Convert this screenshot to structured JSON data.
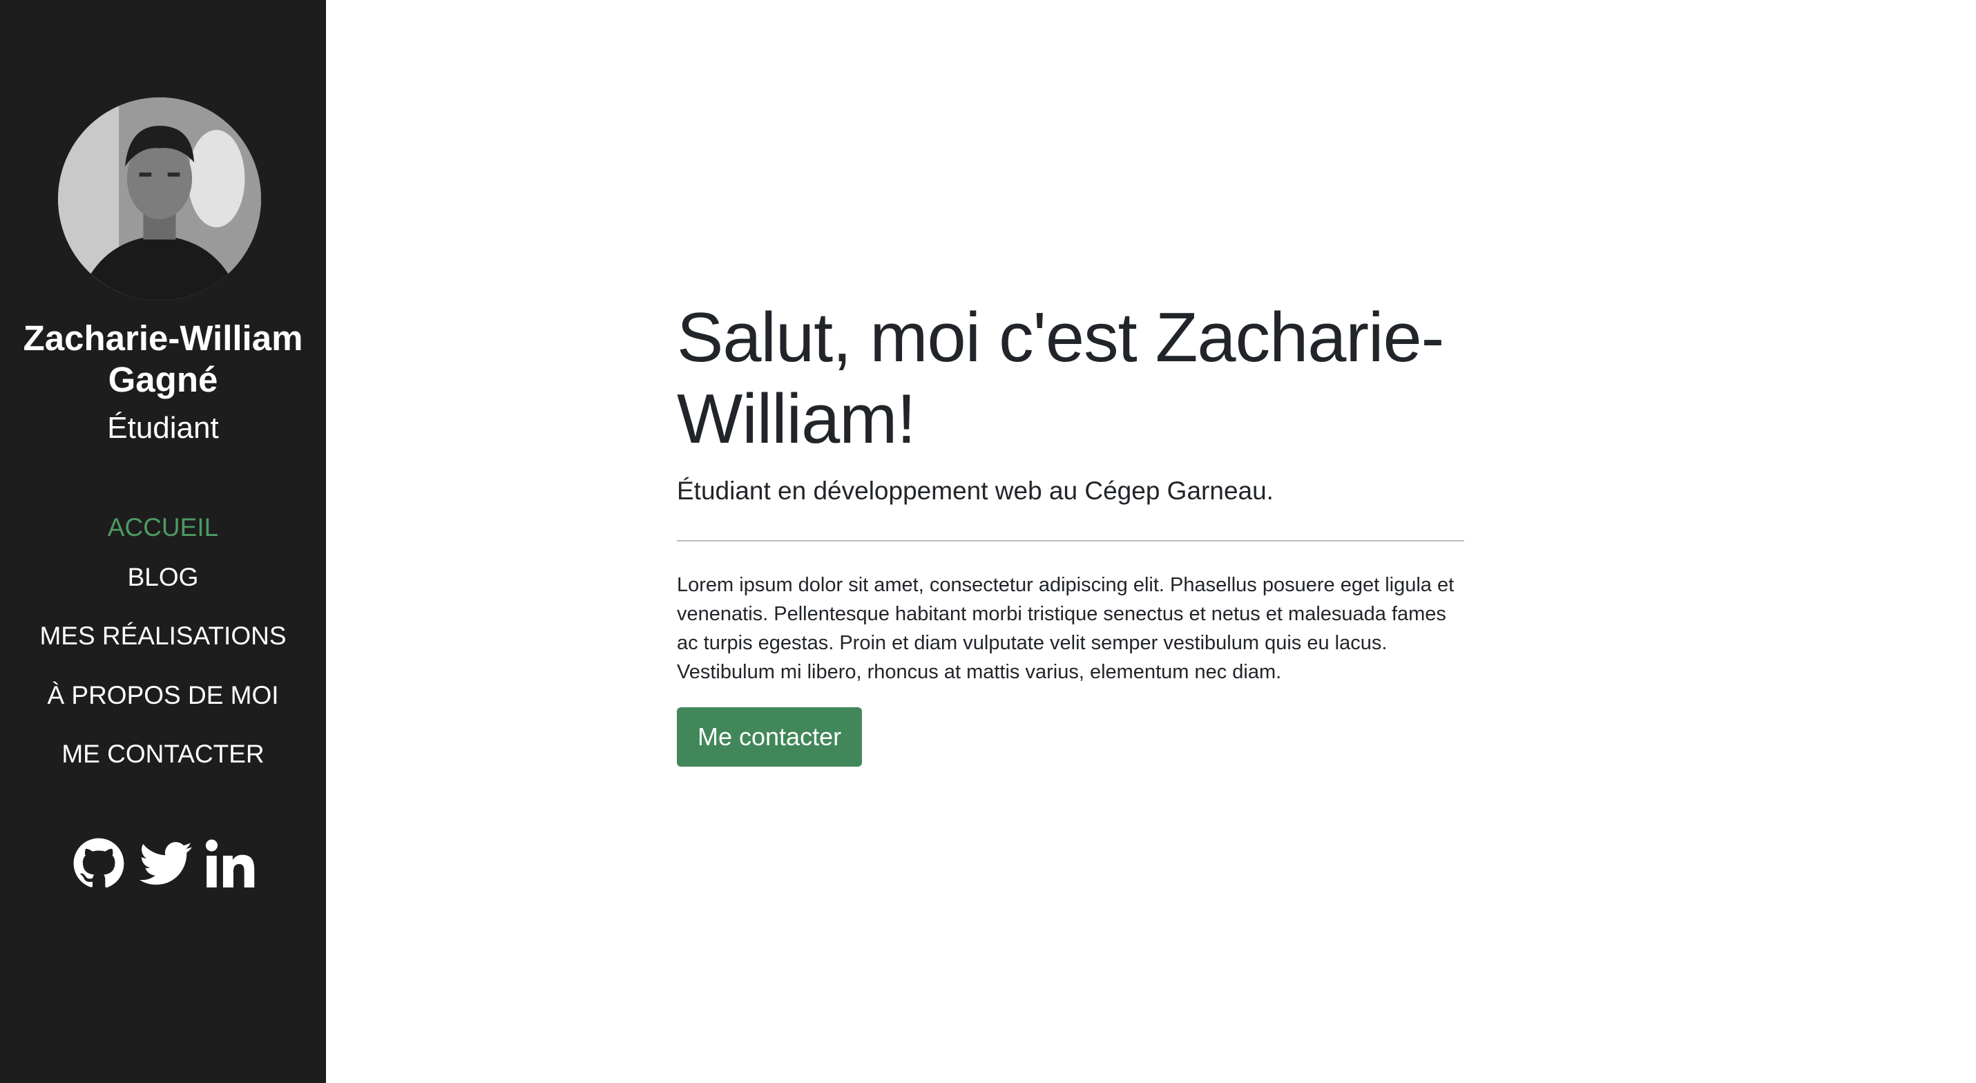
{
  "sidebar": {
    "name": "Zacharie-William Gagné",
    "role": "Étudiant",
    "nav": [
      {
        "label": "ACCUEIL",
        "active": true
      },
      {
        "label": "BLOG",
        "active": false
      },
      {
        "label": "MES RÉALISATIONS",
        "active": false
      },
      {
        "label": "À PROPOS DE MOI",
        "active": false
      },
      {
        "label": "ME CONTACTER",
        "active": false
      }
    ],
    "socials": [
      "github-icon",
      "twitter-icon",
      "linkedin-icon"
    ]
  },
  "main": {
    "headline": "Salut, moi c'est Zacharie-William!",
    "subtitle": "Étudiant en développement web au Cégep Garneau.",
    "body": "Lorem ipsum dolor sit amet, consectetur adipiscing elit. Phasellus posuere eget ligula et venenatis. Pellentesque habitant morbi tristique senectus et netus et malesuada fames ac turpis egestas. Proin et diam vulputate velit semper vestibulum quis eu lacus. Vestibulum mi libero, rhoncus at mattis varius, elementum nec diam.",
    "button_label": "Me contacter"
  },
  "colors": {
    "sidebar_bg": "#1d1d1d",
    "accent": "#41875a",
    "active_nav": "#4d9a62",
    "text": "#212529"
  }
}
